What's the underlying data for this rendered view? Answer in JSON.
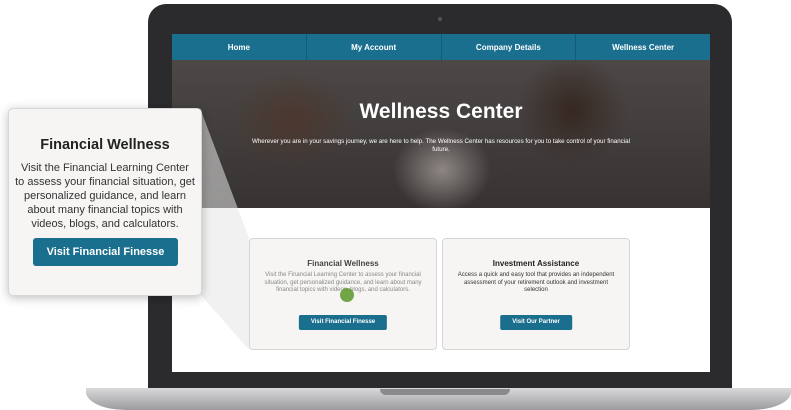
{
  "nav": {
    "items": [
      "Home",
      "My Account",
      "Company Details",
      "Wellness Center"
    ]
  },
  "hero": {
    "title": "Wellness Center",
    "subtitle": "Wherever you are in your savings journey, we are here to help. The Wellness Center has resources for you to take control of your financial future."
  },
  "cards": [
    {
      "title": "Financial Wellness",
      "text": "Visit the Financial Learning Center to assess your financial situation, get personalized guidance, and learn about many financial topics with videos, blogs, and calculators.",
      "button": "Visit Financial Finesse"
    },
    {
      "title": "Investment Assistance",
      "text": "Access a quick and easy tool that provides an independent assessment of your retirement outlook and investment selection",
      "button": "Visit Our Partner"
    }
  ],
  "callout": {
    "title": "Financial Wellness",
    "text": "Visit the Financial Learning Center to assess your financial situation, get personalized guidance, and learn about many financial topics with videos, blogs, and calculators.",
    "button": "Visit Financial Finesse"
  },
  "colors": {
    "nav_bg": "#1a6f8e",
    "button_bg": "#1a6f8e",
    "card_bg": "#f6f5f4",
    "laptop_frame": "#2b2b2d"
  }
}
